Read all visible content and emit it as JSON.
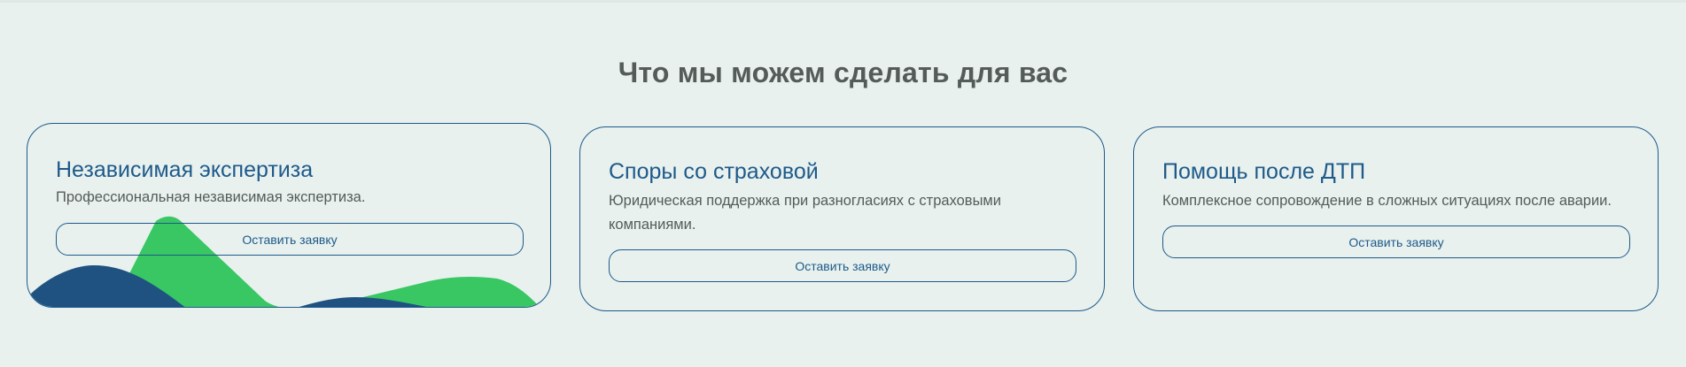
{
  "section": {
    "title": "Что мы можем сделать для вас"
  },
  "cards": [
    {
      "title": "Независимая экспертиза",
      "description": "Профессиональная независимая экспертиза.",
      "button_label": "Оставить заявку"
    },
    {
      "title": "Споры со страховой",
      "description": "Юридическая поддержка при разногласиях с страховыми компаниями.",
      "button_label": "Оставить заявку"
    },
    {
      "title": "Помощь после ДТП",
      "description": "Комплексное сопровождение в сложных ситуациях после аварии.",
      "button_label": "Оставить заявку"
    }
  ],
  "colors": {
    "background": "#e8f1ee",
    "accent_blue": "#1e5a8a",
    "heading_gray": "#555b59",
    "deco_green": "#38c763",
    "deco_navy": "#1f5281"
  }
}
